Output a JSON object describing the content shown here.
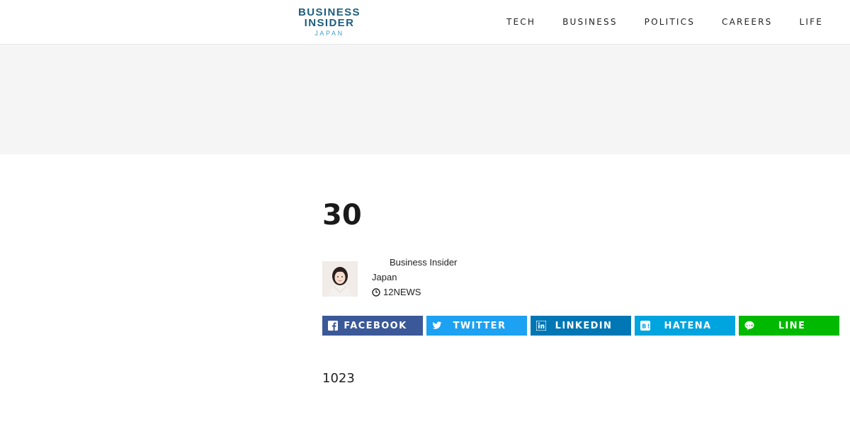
{
  "header": {
    "logo": {
      "line1": "BUSINESS",
      "line2": "INSIDER",
      "sub": "JAPAN",
      "primary_color": "#1d5d7e",
      "accent_color": "#3aa0d0"
    },
    "nav": [
      {
        "label": "TECH"
      },
      {
        "label": "BUSINESS"
      },
      {
        "label": "POLITICS"
      },
      {
        "label": "CAREERS"
      },
      {
        "label": "LIFE"
      }
    ]
  },
  "article": {
    "title": "30",
    "author": {
      "name_line1": "Business Insider",
      "name_line2": "Japan",
      "avatar_icon": "author-avatar"
    },
    "meta": {
      "clock_icon": "clock-icon",
      "date_prefix": "12",
      "category": "NEWS"
    },
    "share": [
      {
        "label": "FACEBOOK",
        "icon": "facebook-icon",
        "color": "#3b5998"
      },
      {
        "label": "TWITTER",
        "icon": "twitter-icon",
        "color": "#1da1f2"
      },
      {
        "label": "LINKEDIN",
        "icon": "linkedin-icon",
        "color": "#0077b5"
      },
      {
        "label": "HATENA",
        "icon": "hatena-icon",
        "color": "#00a4de"
      },
      {
        "label": "LINE",
        "icon": "line-icon",
        "color": "#00b900"
      }
    ],
    "body_text": "1023"
  }
}
